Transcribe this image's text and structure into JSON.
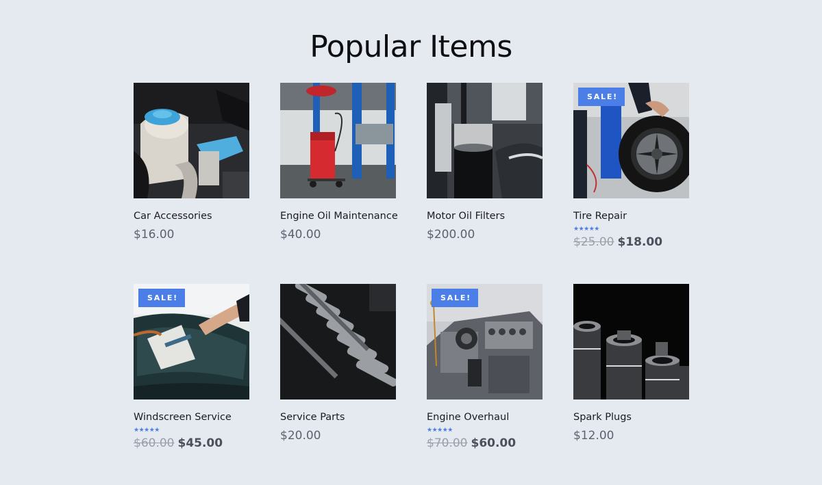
{
  "section": {
    "title": "Popular Items"
  },
  "products": [
    {
      "name": "Car Accessories",
      "price": "$16.00",
      "image": "engine-bay-coolant-reservoir-photo",
      "accent": "#4fa9d6"
    },
    {
      "name": "Engine Oil Maintenance",
      "price": "$40.00",
      "image": "garage-oil-drainer-lift-photo",
      "accent": "#d9262b"
    },
    {
      "name": "Motor Oil Filters",
      "price": "$200.00",
      "image": "oil-filter-under-lift-photo",
      "accent": "#1b1d22"
    },
    {
      "name": "Tire Repair",
      "badge": "SALE!",
      "rating": "★★★★★",
      "old_price": "$25.00",
      "new_price": "$18.00",
      "image": "mechanic-holding-tire-photo",
      "accent": "#2550b8"
    },
    {
      "name": "Windscreen Service",
      "badge": "SALE!",
      "rating": "★★★★★",
      "old_price": "$60.00",
      "new_price": "$45.00",
      "image": "windscreen-glass-repair-photo",
      "accent": "#1f3b3e"
    },
    {
      "name": "Service Parts",
      "price": "$20.00",
      "image": "socket-wrench-set-photo",
      "accent": "#8a8c90"
    },
    {
      "name": "Engine Overhaul",
      "badge": "SALE!",
      "rating": "★★★★★",
      "old_price": "$70.00",
      "new_price": "$60.00",
      "image": "engine-block-photo",
      "accent": "#5a5d64"
    },
    {
      "name": "Spark Plugs",
      "price": "$12.00",
      "image": "spark-plug-sockets-photo",
      "accent": "#0d0d0f"
    }
  ]
}
